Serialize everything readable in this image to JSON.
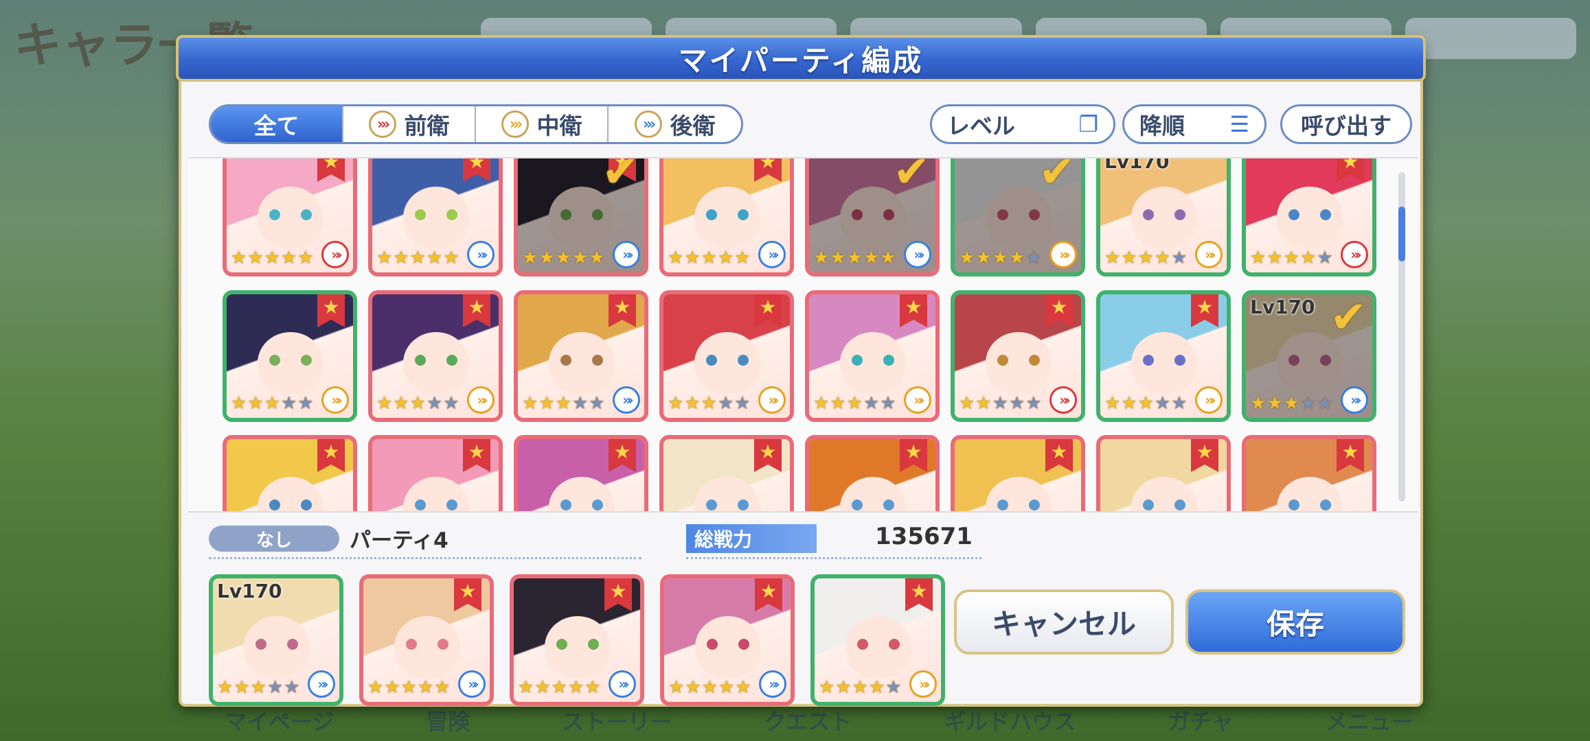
{
  "background": {
    "title": "キャラ一覧",
    "nav": [
      "マイページ",
      "冒険",
      "ストーリー",
      "クエスト",
      "ギルドハウス",
      "ガチャ",
      "メニュー"
    ]
  },
  "dialog": {
    "title": "マイパーティ編成",
    "filter_tabs": [
      {
        "label": "全て",
        "active": true
      },
      {
        "label": "前衛",
        "active": false
      },
      {
        "label": "中衛",
        "active": false
      },
      {
        "label": "後衛",
        "active": false
      }
    ],
    "sort_key_label": "レベル",
    "sort_order_label": "降順",
    "load_label": "呼び出す"
  },
  "roster": [
    [
      {
        "stars": 5,
        "frame": "red",
        "role": "front",
        "hair": "#f5a9c4",
        "eyes": "#4ab3c9",
        "checked": false,
        "flag": true
      },
      {
        "stars": 5,
        "frame": "red",
        "role": "back",
        "hair": "#3e5fa8",
        "eyes": "#9acb4c",
        "checked": false,
        "flag": true
      },
      {
        "stars": 5,
        "frame": "red",
        "role": "back",
        "hair": "#2a2530",
        "eyes": "#6fae52",
        "checked": true,
        "flag": true
      },
      {
        "stars": 5,
        "frame": "red",
        "role": "back",
        "hair": "#f2c060",
        "eyes": "#3fa3c8",
        "checked": false,
        "flag": true
      },
      {
        "stars": 5,
        "frame": "red",
        "role": "back",
        "hair": "#d67ba8",
        "eyes": "#c94a6a",
        "checked": true,
        "flag": false
      },
      {
        "stars": 4,
        "frame": "green",
        "role": "mid",
        "hair": "#f1eeee",
        "eyes": "#d05a6a",
        "checked": true,
        "flag": false
      },
      {
        "stars": 4,
        "frame": "green",
        "role": "mid",
        "hair": "#f0c078",
        "eyes": "#8a6ab0",
        "checked": false,
        "flag": false,
        "level": "Lv170"
      },
      {
        "stars": 4,
        "frame": "green",
        "role": "front",
        "hair": "#e23a5a",
        "eyes": "#4a86c8",
        "checked": false,
        "flag": true
      }
    ],
    [
      {
        "stars": 3,
        "frame": "green",
        "role": "mid",
        "hair": "#2e2b55",
        "eyes": "#7ab05a",
        "checked": false,
        "flag": true
      },
      {
        "stars": 3,
        "frame": "red",
        "role": "mid",
        "hair": "#4a2f6a",
        "eyes": "#5aa85a",
        "checked": false,
        "flag": true
      },
      {
        "stars": 3,
        "frame": "red",
        "role": "back",
        "hair": "#e0a84a",
        "eyes": "#a8784a",
        "checked": false,
        "flag": true
      },
      {
        "stars": 3,
        "frame": "red",
        "role": "mid",
        "hair": "#d8404a",
        "eyes": "#4a8ac0",
        "checked": false,
        "flag": true
      },
      {
        "stars": 3,
        "frame": "red",
        "role": "mid",
        "hair": "#d888c0",
        "eyes": "#3ab0b8",
        "checked": false,
        "flag": true
      },
      {
        "stars": 2,
        "frame": "green",
        "role": "front",
        "hair": "#b8454a",
        "eyes": "#c08a3a",
        "checked": false,
        "flag": true
      },
      {
        "stars": 3,
        "frame": "green",
        "role": "mid",
        "hair": "#8acde8",
        "eyes": "#6a70c8",
        "checked": false,
        "flag": true
      },
      {
        "stars": 3,
        "frame": "green",
        "role": "back",
        "hair": "#f1dcb0",
        "eyes": "#c06a8a",
        "checked": true,
        "flag": false,
        "level": "Lv170"
      }
    ],
    [
      {
        "stars": 0,
        "frame": "red",
        "role": "mid",
        "hair": "#f2c84a",
        "eyes": "#4a8ac0",
        "checked": false,
        "flag": true
      },
      {
        "stars": 0,
        "frame": "red",
        "role": "mid",
        "hair": "#f39ab8",
        "eyes": "#5a9ad0",
        "checked": false,
        "flag": true
      },
      {
        "stars": 0,
        "frame": "red",
        "role": "mid",
        "hair": "#c860a8",
        "eyes": "#5a9ad0",
        "checked": false,
        "flag": true
      },
      {
        "stars": 0,
        "frame": "red",
        "role": "mid",
        "hair": "#f3e6c8",
        "eyes": "#5a9ad0",
        "checked": false,
        "flag": true
      },
      {
        "stars": 0,
        "frame": "red",
        "role": "mid",
        "hair": "#e0782a",
        "eyes": "#5a9ad0",
        "checked": false,
        "flag": true
      },
      {
        "stars": 0,
        "frame": "red",
        "role": "mid",
        "hair": "#f0c050",
        "eyes": "#5a9ad0",
        "checked": false,
        "flag": true
      },
      {
        "stars": 0,
        "frame": "red",
        "role": "mid",
        "hair": "#f1d8a0",
        "eyes": "#5a9ad0",
        "checked": false,
        "flag": true
      },
      {
        "stars": 0,
        "frame": "red",
        "role": "mid",
        "hair": "#e08a50",
        "eyes": "#5a9ad0",
        "checked": false,
        "flag": true
      }
    ]
  ],
  "party": {
    "badge": "なし",
    "name": "パーティ4",
    "power_label": "総戦力",
    "power_value": "135671",
    "members": [
      {
        "stars": 3,
        "frame": "green",
        "role": "back",
        "hair": "#f1dcb0",
        "eyes": "#c06a8a",
        "level": "Lv170",
        "flag": false
      },
      {
        "stars": 5,
        "frame": "red",
        "role": "back",
        "hair": "#f0c8a0",
        "eyes": "#e07a8a",
        "flag": true
      },
      {
        "stars": 5,
        "frame": "red",
        "role": "back",
        "hair": "#2a2530",
        "eyes": "#6fae52",
        "flag": true
      },
      {
        "stars": 5,
        "frame": "red",
        "role": "back",
        "hair": "#d67ba8",
        "eyes": "#c94a6a",
        "flag": true
      },
      {
        "stars": 4,
        "frame": "green",
        "role": "mid",
        "hair": "#f1eeee",
        "eyes": "#d05a6a",
        "flag": true
      }
    ]
  },
  "buttons": {
    "cancel": "キャンセル",
    "save": "保存"
  },
  "colors": {
    "role_front": "#d8383e",
    "role_mid": "#e6a21e",
    "role_back": "#3a7fe0"
  }
}
